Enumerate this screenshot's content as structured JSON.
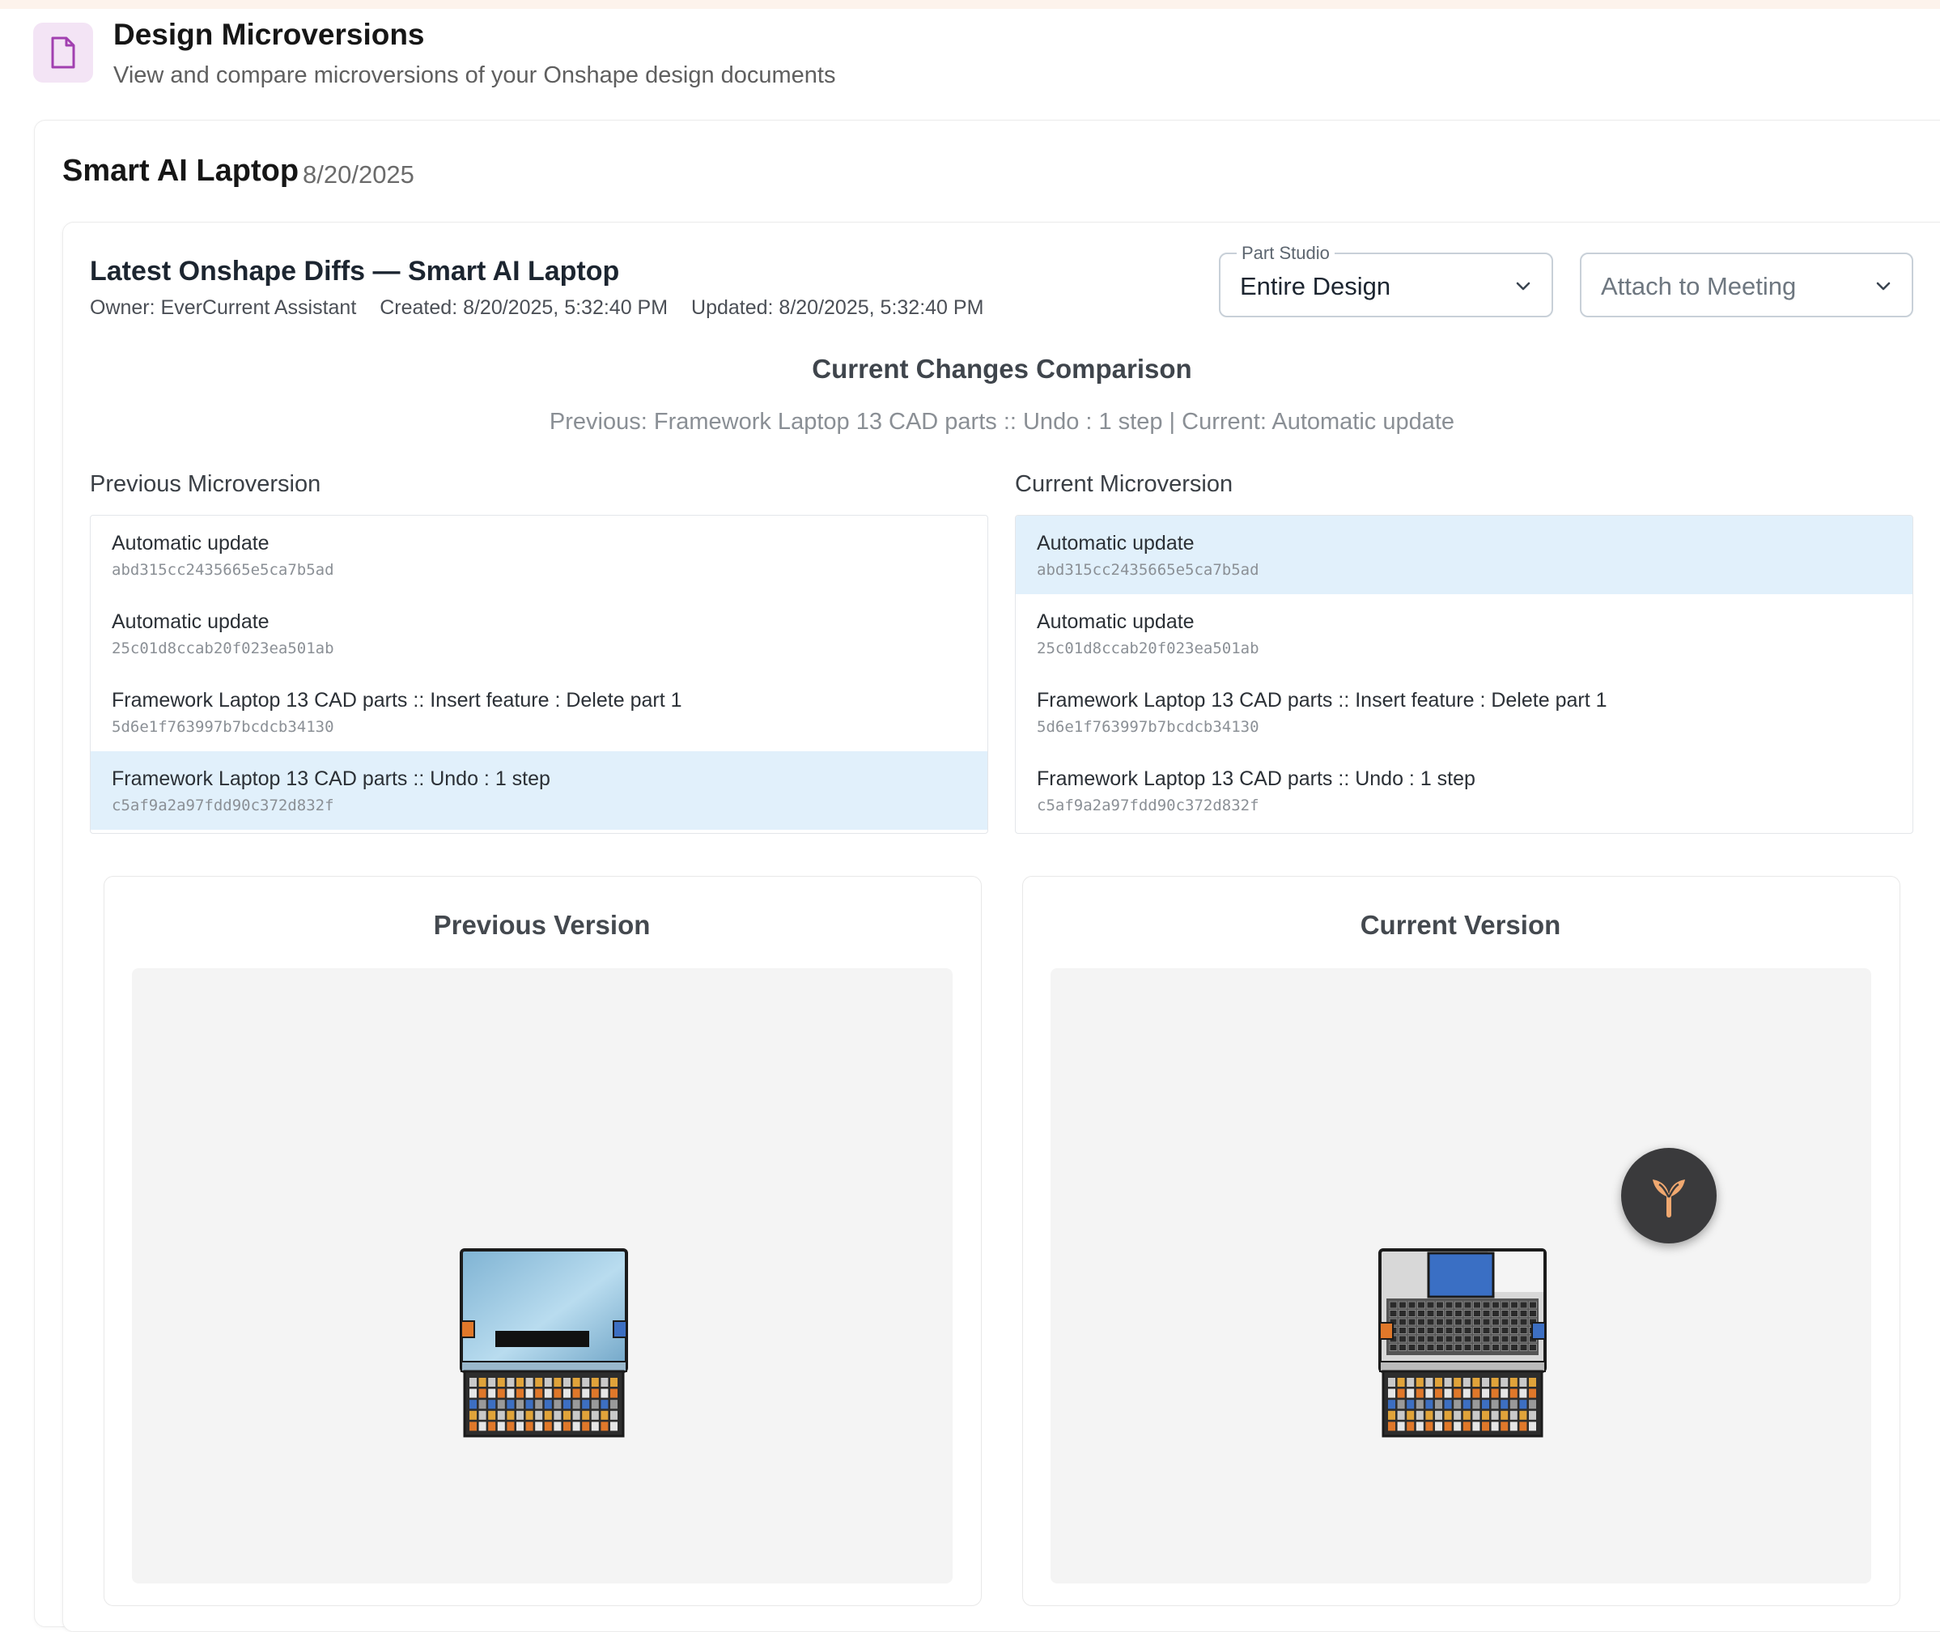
{
  "header": {
    "icon": "document-icon",
    "title": "Design Microversions",
    "subtitle": "View and compare microversions of your Onshape design documents"
  },
  "document": {
    "title": "Smart AI Laptop",
    "date": "8/20/2025"
  },
  "diff": {
    "title": "Latest Onshape Diffs — Smart AI Laptop",
    "owner": "Owner: EverCurrent Assistant",
    "created": "Created: 8/20/2025, 5:32:40 PM",
    "updated": "Updated: 8/20/2025, 5:32:40 PM"
  },
  "part_studio": {
    "label": "Part Studio",
    "value": "Entire Design"
  },
  "attach": {
    "placeholder": "Attach to Meeting"
  },
  "comparison": {
    "title": "Current Changes Comparison",
    "subtitle": "Previous: Framework Laptop 13 CAD parts :: Undo : 1 step | Current: Automatic update"
  },
  "previous_list": {
    "label": "Previous Microversion",
    "items": [
      {
        "name": "Automatic update",
        "hash": "abd315cc2435665e5ca7b5ad",
        "selected": false
      },
      {
        "name": "Automatic update",
        "hash": "25c01d8ccab20f023ea501ab",
        "selected": false
      },
      {
        "name": "Framework Laptop 13 CAD parts :: Insert feature : Delete part 1",
        "hash": "5d6e1f763997b7bcdcb34130",
        "selected": false
      },
      {
        "name": "Framework Laptop 13 CAD parts :: Undo : 1 step",
        "hash": "c5af9a2a97fdd90c372d832f",
        "selected": true
      }
    ]
  },
  "current_list": {
    "label": "Current Microversion",
    "items": [
      {
        "name": "Automatic update",
        "hash": "abd315cc2435665e5ca7b5ad",
        "selected": true
      },
      {
        "name": "Automatic update",
        "hash": "25c01d8ccab20f023ea501ab",
        "selected": false
      },
      {
        "name": "Framework Laptop 13 CAD parts :: Insert feature : Delete part 1",
        "hash": "5d6e1f763997b7bcdcb34130",
        "selected": false
      },
      {
        "name": "Framework Laptop 13 CAD parts :: Undo : 1 step",
        "hash": "c5af9a2a97fdd90c372d832f",
        "selected": false
      }
    ]
  },
  "previous_version": {
    "title": "Previous Version"
  },
  "current_version": {
    "title": "Current Version"
  },
  "colors": {
    "selected_row": "#e1f0fb",
    "icon_bg": "#f3e4f5",
    "icon_stroke": "#a13fb0",
    "fab_bg": "#3a3a3c",
    "fab_icon": "#f0a870"
  },
  "fab": {
    "icon": "sprout-icon"
  }
}
